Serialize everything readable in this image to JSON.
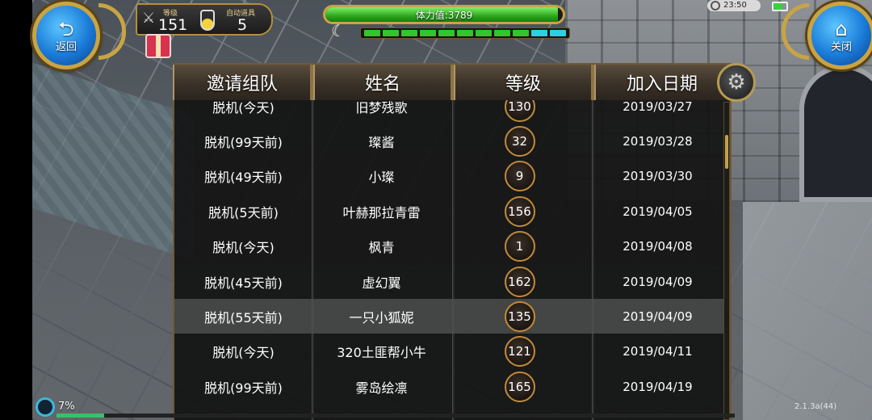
{
  "hud": {
    "back_label": "返回",
    "close_label": "关闭",
    "level_caption": "等级",
    "level_value": "151",
    "auto_caption": "自动道具",
    "auto_value": "5",
    "stamina_text": "体力值:3789",
    "stamina_fraction": 0.98,
    "clock": "23:50",
    "segments": [
      "#2fc72a",
      "#2fc72a",
      "#2fc72a",
      "#2fc72a",
      "#2fc72a",
      "#2fc72a",
      "#2fc72a",
      "#2fc72a",
      "#2fc72a",
      "#2bd1e0",
      "#2bd1e0"
    ]
  },
  "table": {
    "headers": [
      "邀请组队",
      "姓名",
      "等级",
      "加入日期"
    ],
    "rows": [
      {
        "status": "脱机(今天)",
        "name": "旧梦残歌",
        "level": "130",
        "date": "2019/03/27"
      },
      {
        "status": "脱机(99天前)",
        "name": "璨酱",
        "level": "32",
        "date": "2019/03/28"
      },
      {
        "status": "脱机(49天前)",
        "name": "小璨",
        "level": "9",
        "date": "2019/03/30"
      },
      {
        "status": "脱机(5天前)",
        "name": "叶赫那拉青雷",
        "level": "156",
        "date": "2019/04/05"
      },
      {
        "status": "脱机(今天)",
        "name": "枫青",
        "level": "1",
        "date": "2019/04/08"
      },
      {
        "status": "脱机(45天前)",
        "name": "虚幻翼",
        "level": "162",
        "date": "2019/04/09"
      },
      {
        "status": "脱机(55天前)",
        "name": "一只小狐妮",
        "level": "135",
        "date": "2019/04/09",
        "highlighted": true
      },
      {
        "status": "脱机(今天)",
        "name": "320土匪帮小牛",
        "level": "121",
        "date": "2019/04/11"
      },
      {
        "status": "脱机(99天前)",
        "name": "雾岛绘凛",
        "level": "165",
        "date": "2019/04/19"
      }
    ]
  },
  "footer": {
    "progress_text": "7%",
    "progress_fraction": 0.07,
    "version": "2.1.3a(44)"
  }
}
